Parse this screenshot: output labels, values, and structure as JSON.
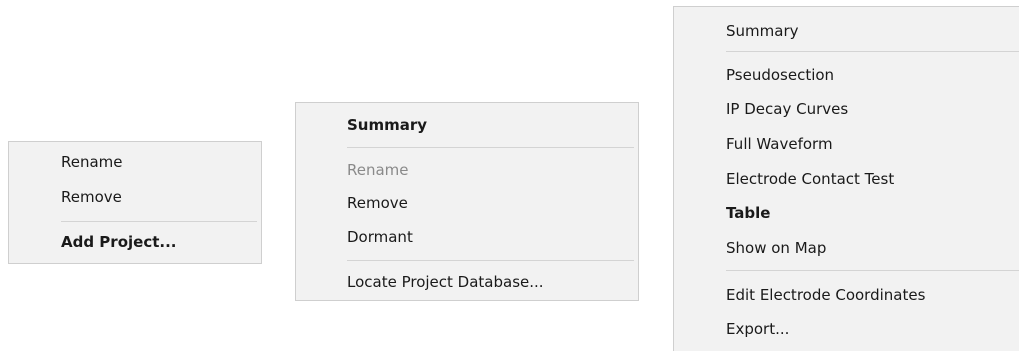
{
  "menu1": {
    "items": [
      "Rename",
      "Remove",
      "Add Project..."
    ]
  },
  "menu2": {
    "items": [
      "Summary",
      "Rename",
      "Remove",
      "Dormant",
      "Locate Project Database..."
    ]
  },
  "menu3": {
    "items": [
      "Summary",
      "Pseudosection",
      "IP Decay Curves",
      "Full Waveform",
      "Electrode Contact Test",
      "Table",
      "Show on Map",
      "Edit Electrode Coordinates",
      "Export..."
    ]
  }
}
